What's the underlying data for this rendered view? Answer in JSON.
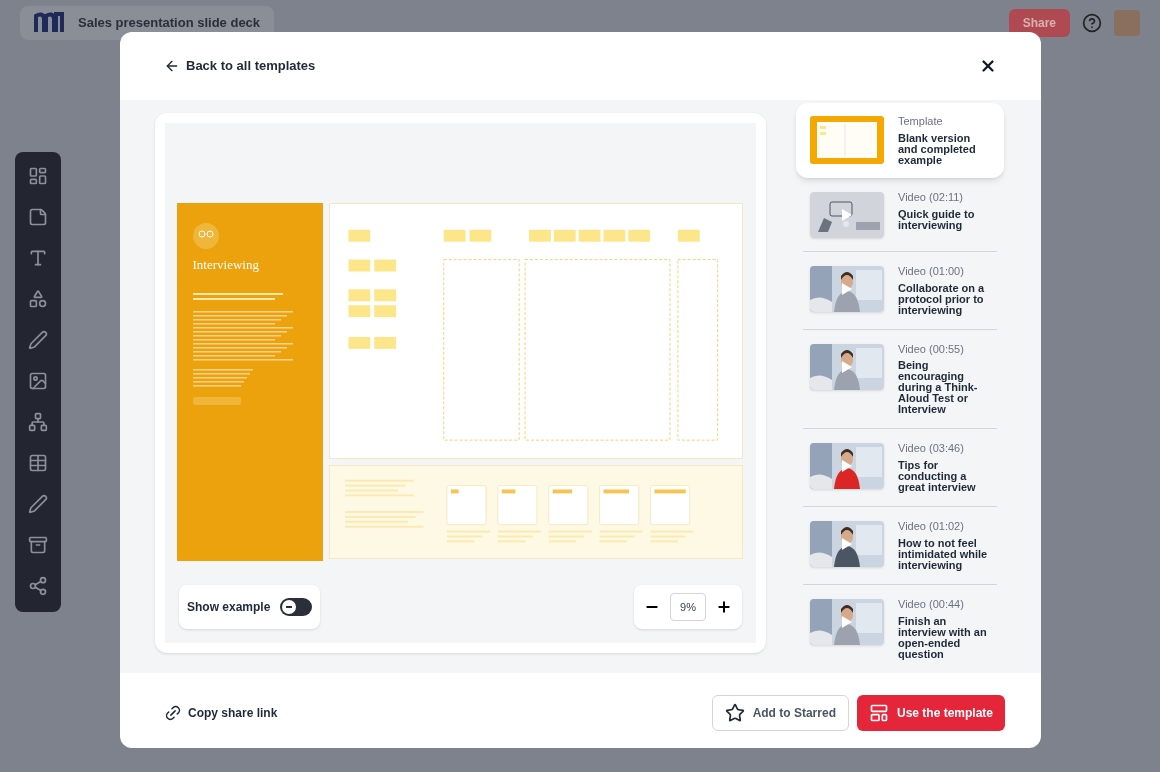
{
  "app": {
    "title": "Sales presentation slide deck",
    "share_button": "Share"
  },
  "modal": {
    "back_link": "Back to all templates",
    "preview": {
      "doc_title": "Interviewing",
      "show_example": {
        "label": "Show example",
        "on": false
      },
      "zoom_value": "9%"
    },
    "resources": [
      {
        "kind": "template",
        "type_label": "Template",
        "title": "Blank version and completed example",
        "selected": true
      },
      {
        "kind": "video",
        "type_label": "Video (02:11)",
        "title": "Quick guide to interviewing",
        "selected": false
      },
      {
        "kind": "video",
        "type_label": "Video (01:00)",
        "title": "Collaborate on a protocol prior to interviewing",
        "selected": false
      },
      {
        "kind": "video",
        "type_label": "Video (00:55)",
        "title": "Being encouraging during a Think-Aloud Test or Interview",
        "selected": false
      },
      {
        "kind": "video",
        "type_label": "Video (03:46)",
        "title": "Tips for conducting a great interview",
        "selected": false
      },
      {
        "kind": "video",
        "type_label": "Video (01:02)",
        "title": "How to not feel intimidated while interviewing",
        "selected": false
      },
      {
        "kind": "video",
        "type_label": "Video (00:44)",
        "title": "Finish an interview with an open-ended question",
        "selected": false
      }
    ],
    "footer": {
      "copy_link": "Copy share link",
      "add_starred": "Add to Starred",
      "use_template": "Use the template"
    }
  }
}
